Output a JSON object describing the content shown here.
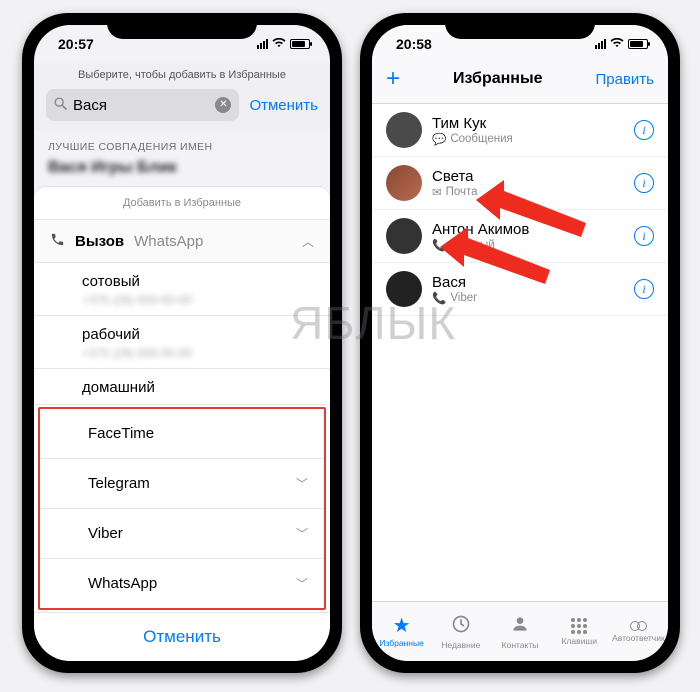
{
  "watermark": "ЯБЛЫК",
  "left": {
    "status_time": "20:57",
    "header_prompt": "Выберите, чтобы добавить в Избранные",
    "search_value": "Вася",
    "search_cancel": "Отменить",
    "section_best_matches": "ЛУЧШИЕ СОВПАДЕНИЯ ИМЕН",
    "blurred_name": "Вася Игры Блик",
    "sheet_title": "Добавить в Избранные",
    "call_label": "Вызов",
    "call_via": "WhatsApp",
    "numbers": [
      {
        "label": "сотовый"
      },
      {
        "label": "рабочий"
      },
      {
        "label": "домашний"
      }
    ],
    "apps": [
      {
        "label": "FaceTime",
        "expandable": false
      },
      {
        "label": "Telegram",
        "expandable": true
      },
      {
        "label": "Viber",
        "expandable": true
      },
      {
        "label": "WhatsApp",
        "expandable": true
      }
    ],
    "cancel_button": "Отменить"
  },
  "right": {
    "status_time": "20:58",
    "nav_add": "+",
    "nav_title": "Избранные",
    "nav_edit": "Править",
    "favorites": [
      {
        "name": "Тим Кук",
        "sub_icon": "message",
        "sub": "Сообщения"
      },
      {
        "name": "Света",
        "sub_icon": "mail",
        "sub": "Почта"
      },
      {
        "name": "Антон Акимов",
        "sub_icon": "phone",
        "sub": "сотовый"
      },
      {
        "name": "Вася",
        "sub_icon": "phone",
        "sub": "Viber"
      }
    ],
    "tabs": [
      {
        "icon": "★",
        "label": "Избранные",
        "active": true
      },
      {
        "icon": "🕒",
        "label": "Недавние",
        "active": false
      },
      {
        "icon": "👤",
        "label": "Контакты",
        "active": false
      },
      {
        "icon": "keypad",
        "label": "Клавиши",
        "active": false
      },
      {
        "icon": "voicemail",
        "label": "Автоответчик",
        "active": false
      }
    ]
  }
}
